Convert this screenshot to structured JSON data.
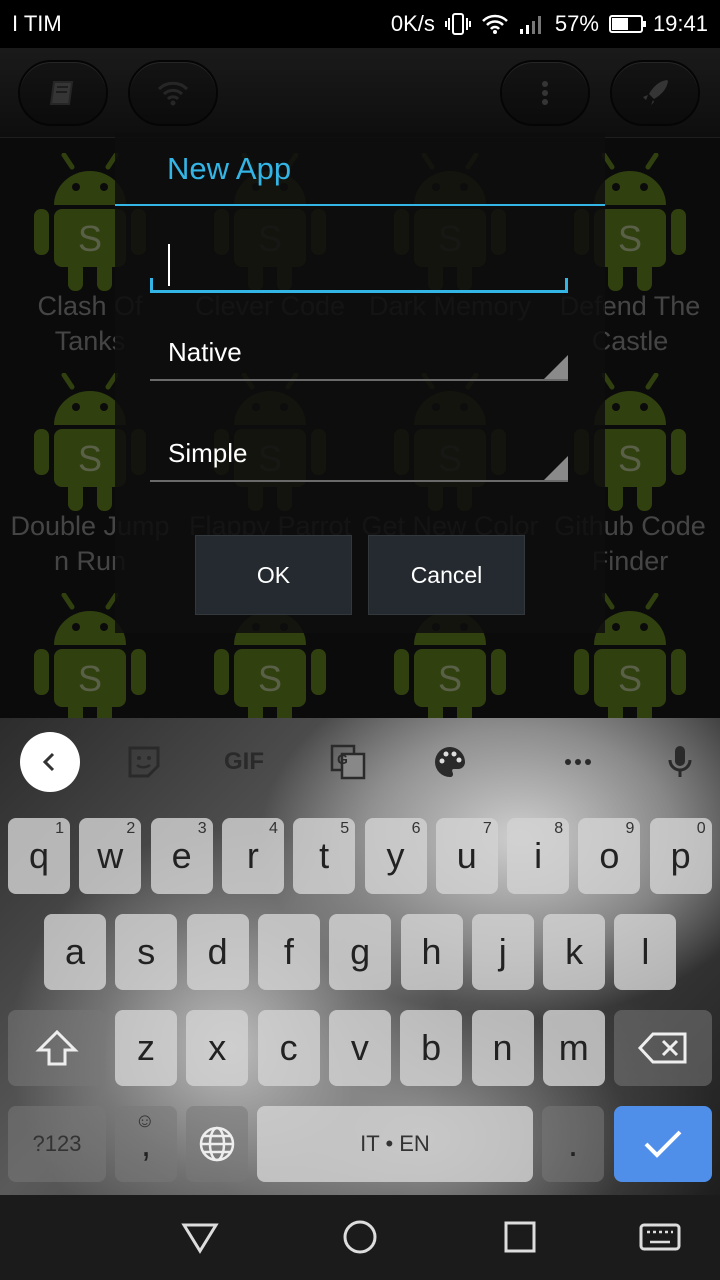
{
  "status_bar": {
    "carrier": "I TIM",
    "speed": "0K/s",
    "battery": "57%",
    "battery_level": 0.57,
    "time": "19:41"
  },
  "toolbar": {
    "icons": [
      "book-icon",
      "wifi-icon",
      "more-vert-icon",
      "rocket-icon"
    ]
  },
  "apps": [
    {
      "label": "Clash Of Tanks"
    },
    {
      "label": "Clever Code"
    },
    {
      "label": "Dark Memory"
    },
    {
      "label": "Defend The Castle"
    },
    {
      "label": "Double Jump n Run"
    },
    {
      "label": "Flappy Parrot 3D"
    },
    {
      "label": "Get New Color"
    },
    {
      "label": "Github Code Finder"
    }
  ],
  "dialog": {
    "title": "New App",
    "name_value": "",
    "type_selected": "Native",
    "template_selected": "Simple",
    "ok_label": "OK",
    "cancel_label": "Cancel"
  },
  "keyboard": {
    "gif_label": "GIF",
    "row1": [
      {
        "k": "q",
        "h": "1"
      },
      {
        "k": "w",
        "h": "2"
      },
      {
        "k": "e",
        "h": "3"
      },
      {
        "k": "r",
        "h": "4"
      },
      {
        "k": "t",
        "h": "5"
      },
      {
        "k": "y",
        "h": "6"
      },
      {
        "k": "u",
        "h": "7"
      },
      {
        "k": "i",
        "h": "8"
      },
      {
        "k": "o",
        "h": "9"
      },
      {
        "k": "p",
        "h": "0"
      }
    ],
    "row2": [
      "a",
      "s",
      "d",
      "f",
      "g",
      "h",
      "j",
      "k",
      "l"
    ],
    "row3": [
      "z",
      "x",
      "c",
      "v",
      "b",
      "n",
      "m"
    ],
    "symbols_label": "?123",
    "comma_label": ",",
    "space_label": "IT • EN",
    "period_label": "."
  },
  "colors": {
    "accent": "#33b5e5",
    "android_green": "#6b8e23",
    "enter_key": "#4f8fea"
  }
}
